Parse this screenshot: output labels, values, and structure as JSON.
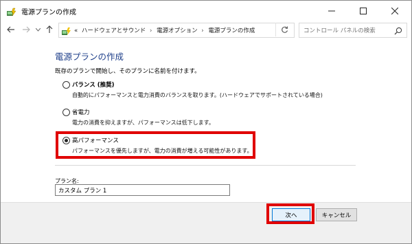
{
  "window": {
    "title": "電源プランの作成",
    "controls": {
      "minimize": "minimize-icon",
      "maximize": "maximize-icon",
      "close": "close-icon"
    }
  },
  "nav": {
    "back_icon": "arrow-left-icon",
    "forward_icon": "arrow-right-icon",
    "recent_icon": "chevron-down-icon",
    "up_icon": "arrow-up-icon",
    "breadcrumb_prefix": "«",
    "breadcrumbs": [
      "ハードウェアとサウンド",
      "電源オプション",
      "電源プランの作成"
    ],
    "separator": "›",
    "refresh_icon": "refresh-icon",
    "search_placeholder": "コントロール パネルの検索"
  },
  "page": {
    "heading": "電源プランの作成",
    "intro": "既存のプランで開始し、そのプランに名前を付けます。",
    "options": [
      {
        "label": "バランス (推奨)",
        "desc": "自動的にパフォーマンスと電力消費のバランスを取ります。(ハードウェアでサポートされている場合)",
        "selected": false
      },
      {
        "label": "省電力",
        "desc": "電力の消費を抑えますが、パフォーマンスは低下します。",
        "selected": false
      },
      {
        "label": "高パフォーマンス",
        "desc": "パフォーマンスを優先しますが、電力の消費が増える可能性があります。",
        "selected": true
      }
    ],
    "plan_name_label": "プラン名:",
    "plan_name_value": "カスタム プラン 1"
  },
  "buttons": {
    "next": "次へ",
    "cancel": "キャンセル"
  },
  "colors": {
    "heading": "#1e3f8a",
    "highlight": "#e00000",
    "accent": "#0078d7"
  }
}
